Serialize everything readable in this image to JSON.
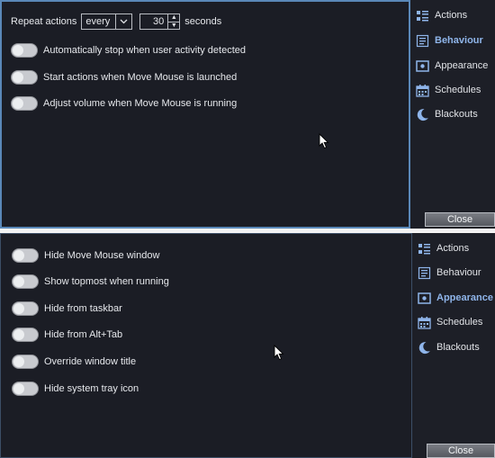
{
  "top": {
    "repeat": {
      "label": "Repeat actions",
      "mode": "every",
      "value": "30",
      "unit": "seconds"
    },
    "toggles": [
      {
        "label": "Automatically stop when user activity detected",
        "on": false
      },
      {
        "label": "Start actions when Move Mouse is launched",
        "on": false
      },
      {
        "label": "Adjust volume when Move Mouse is running",
        "on": false
      }
    ],
    "nav": [
      {
        "label": "Actions",
        "icon": "actions-list-icon",
        "active": false
      },
      {
        "label": "Behaviour",
        "icon": "behaviour-icon",
        "active": true
      },
      {
        "label": "Appearance",
        "icon": "appearance-icon",
        "active": false
      },
      {
        "label": "Schedules",
        "icon": "calendar-icon",
        "active": false
      },
      {
        "label": "Blackouts",
        "icon": "moon-icon",
        "active": false
      }
    ],
    "close_label": "Close"
  },
  "bottom": {
    "toggles": [
      {
        "label": "Hide Move Mouse window",
        "on": false
      },
      {
        "label": "Show topmost when running",
        "on": false
      },
      {
        "label": "Hide from taskbar",
        "on": false
      },
      {
        "label": "Hide from Alt+Tab",
        "on": false
      },
      {
        "label": "Override window title",
        "on": false
      },
      {
        "label": "Hide system tray icon",
        "on": false
      }
    ],
    "nav": [
      {
        "label": "Actions",
        "icon": "actions-list-icon",
        "active": false
      },
      {
        "label": "Behaviour",
        "icon": "behaviour-icon",
        "active": false
      },
      {
        "label": "Appearance",
        "icon": "appearance-icon",
        "active": true
      },
      {
        "label": "Schedules",
        "icon": "calendar-icon",
        "active": false
      },
      {
        "label": "Blackouts",
        "icon": "moon-icon",
        "active": false
      }
    ],
    "close_label": "Close"
  },
  "colors": {
    "accent": "#8fb5ea",
    "background": "#1b1d25",
    "border": "#5a88b8"
  }
}
